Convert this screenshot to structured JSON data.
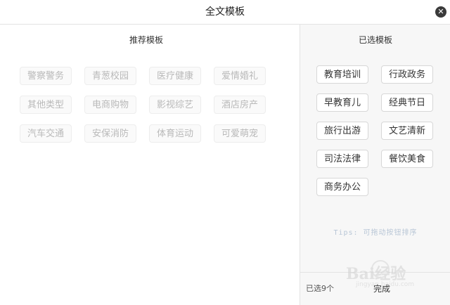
{
  "dialog": {
    "title": "全文模板",
    "close_glyph": "✕"
  },
  "recommended": {
    "title": "推荐模板",
    "items": [
      "警察警务",
      "青葱校园",
      "医疗健康",
      "爱情婚礼",
      "其他类型",
      "电商购物",
      "影视综艺",
      "酒店房产",
      "汽车交通",
      "安保消防",
      "体育运动",
      "可爱萌宠"
    ]
  },
  "selected": {
    "title": "已选模板",
    "items": [
      "教育培训",
      "行政政务",
      "早教育儿",
      "经典节日",
      "旅行出游",
      "文艺清新",
      "司法法律",
      "餐饮美食",
      "商务办公"
    ],
    "tips": "Tips: 可拖动按钮排序",
    "count_label": "已选9个",
    "done_label": "完成"
  },
  "watermark": {
    "brand": "Bai经验",
    "url": "jingyan.baidu.com"
  }
}
